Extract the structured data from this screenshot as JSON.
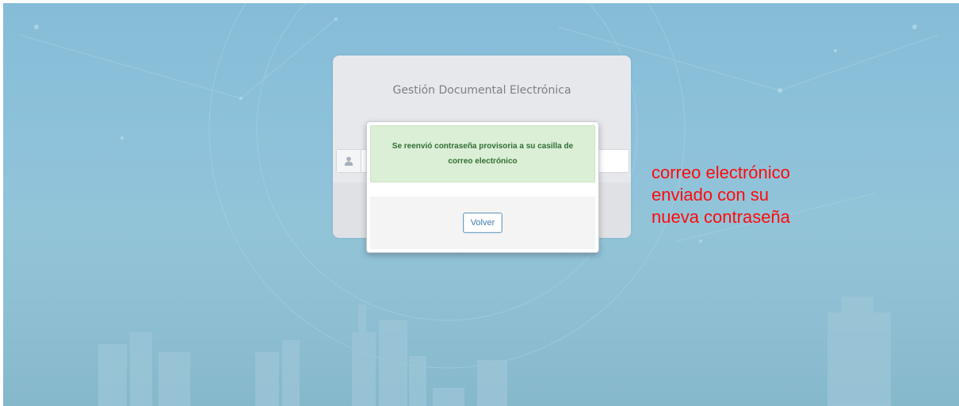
{
  "login": {
    "title": "Gestión Documental Electrónica",
    "username_placeholder": ""
  },
  "modal": {
    "message": "Se reenvió contraseña provisoria a su casilla de correo electrónico",
    "button_label": "Volver"
  },
  "annotation": {
    "lines": [
      "correo electrónico",
      "enviado con su",
      "nueva contraseña"
    ]
  },
  "colors": {
    "background": "#8ec2da",
    "alert_bg": "#dbefd6",
    "alert_text": "#2f6e33",
    "annotation": "#ff0a0a",
    "button_border": "#6ea3c6"
  },
  "icons": {
    "user": "user-icon"
  }
}
